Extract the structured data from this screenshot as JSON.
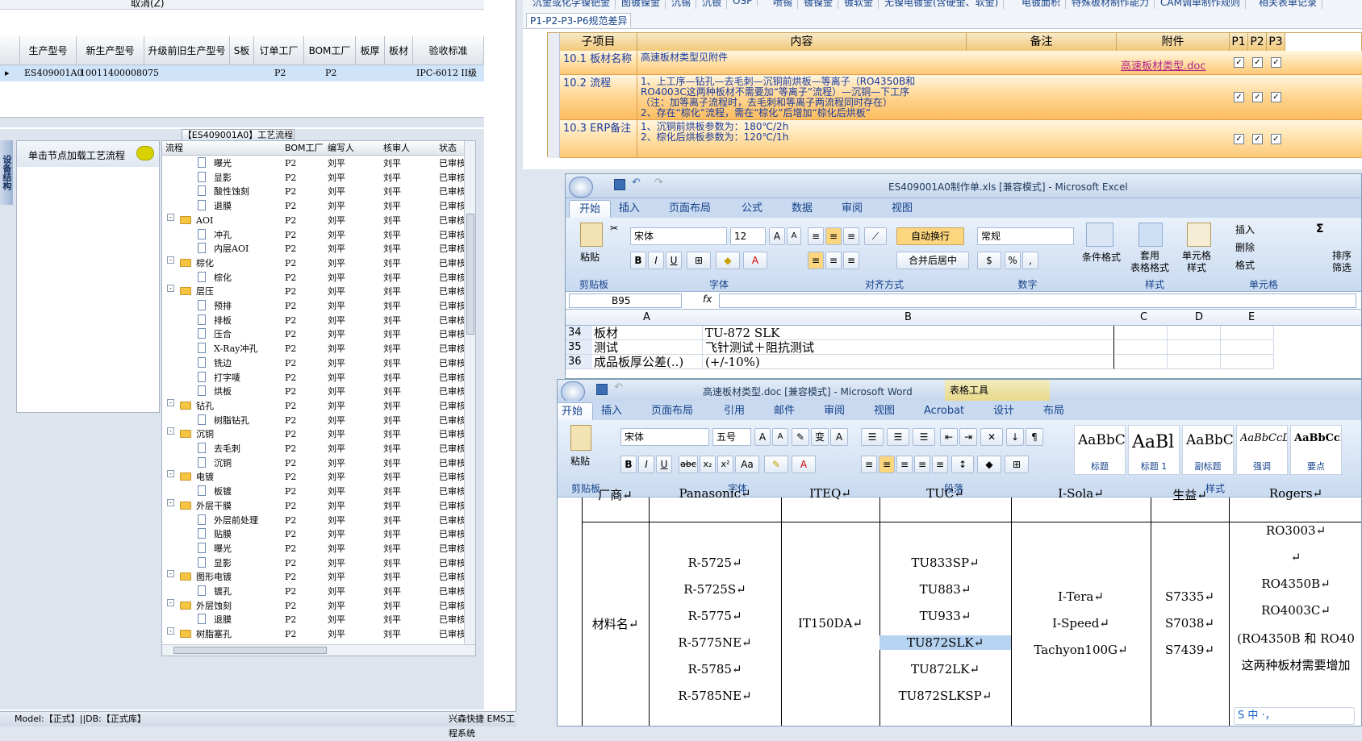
{
  "left": {
    "top_cancel": "取消(Z)",
    "grid_headers": [
      "生产型号",
      "新生产型号",
      "升级前旧生产型号",
      "S板",
      "订单工厂",
      "BOM工厂",
      "板厚",
      "板材",
      "验收标准"
    ],
    "grid_row": {
      "col1": "ES409001A0",
      "col2": "10011400008075",
      "order_factory": "P2",
      "bom_factory": "P2",
      "standard": "IPC-6012 II级"
    },
    "panel_title": "【ES409001A0】工艺流程",
    "side_tab": "设备结构",
    "node_load": "单击节点加载工艺流程",
    "tree_headers": [
      "流程",
      "BOM工厂",
      "编写人",
      "核审人",
      "状态"
    ],
    "tree_rows": [
      {
        "name": "曝光",
        "type": "doc",
        "level": 2,
        "f": "P2",
        "w": "刘平",
        "r": "刘平",
        "s": "已审核"
      },
      {
        "name": "显影",
        "type": "doc",
        "level": 2,
        "f": "P2",
        "w": "刘平",
        "r": "刘平",
        "s": "已审核"
      },
      {
        "name": "酸性蚀刻",
        "type": "doc",
        "level": 2,
        "f": "P2",
        "w": "刘平",
        "r": "刘平",
        "s": "已审核"
      },
      {
        "name": "退膜",
        "type": "doc",
        "level": 2,
        "f": "P2",
        "w": "刘平",
        "r": "刘平",
        "s": "已审核"
      },
      {
        "name": "AOI",
        "type": "folder",
        "level": 1,
        "f": "P2",
        "w": "刘平",
        "r": "刘平",
        "s": "已审核"
      },
      {
        "name": "冲孔",
        "type": "doc",
        "level": 2,
        "f": "P2",
        "w": "刘平",
        "r": "刘平",
        "s": "已审核"
      },
      {
        "name": "内层AOI",
        "type": "doc",
        "level": 2,
        "f": "P2",
        "w": "刘平",
        "r": "刘平",
        "s": "已审核"
      },
      {
        "name": "棕化",
        "type": "folder",
        "level": 1,
        "f": "P2",
        "w": "刘平",
        "r": "刘平",
        "s": "已审核"
      },
      {
        "name": "棕化",
        "type": "doc",
        "level": 2,
        "f": "P2",
        "w": "刘平",
        "r": "刘平",
        "s": "已审核"
      },
      {
        "name": "层压",
        "type": "folder",
        "level": 1,
        "f": "P2",
        "w": "刘平",
        "r": "刘平",
        "s": "已审核"
      },
      {
        "name": "预排",
        "type": "doc",
        "level": 2,
        "f": "P2",
        "w": "刘平",
        "r": "刘平",
        "s": "已审核"
      },
      {
        "name": "排板",
        "type": "doc",
        "level": 2,
        "f": "P2",
        "w": "刘平",
        "r": "刘平",
        "s": "已审核"
      },
      {
        "name": "压合",
        "type": "doc",
        "level": 2,
        "f": "P2",
        "w": "刘平",
        "r": "刘平",
        "s": "已审核"
      },
      {
        "name": "X-Ray冲孔",
        "type": "doc",
        "level": 2,
        "f": "P2",
        "w": "刘平",
        "r": "刘平",
        "s": "已审核"
      },
      {
        "name": "铣边",
        "type": "doc",
        "level": 2,
        "f": "P2",
        "w": "刘平",
        "r": "刘平",
        "s": "已审核"
      },
      {
        "name": "打字唛",
        "type": "doc",
        "level": 2,
        "f": "P2",
        "w": "刘平",
        "r": "刘平",
        "s": "已审核"
      },
      {
        "name": "烘板",
        "type": "doc",
        "level": 2,
        "f": "P2",
        "w": "刘平",
        "r": "刘平",
        "s": "已审核"
      },
      {
        "name": "钻孔",
        "type": "folder",
        "level": 1,
        "f": "P2",
        "w": "刘平",
        "r": "刘平",
        "s": "已审核"
      },
      {
        "name": "树脂钻孔",
        "type": "doc",
        "level": 2,
        "f": "P2",
        "w": "刘平",
        "r": "刘平",
        "s": "已审核"
      },
      {
        "name": "沉铜",
        "type": "folder",
        "level": 1,
        "f": "P2",
        "w": "刘平",
        "r": "刘平",
        "s": "已审核"
      },
      {
        "name": "去毛刺",
        "type": "doc",
        "level": 2,
        "f": "P2",
        "w": "刘平",
        "r": "刘平",
        "s": "已审核"
      },
      {
        "name": "沉铜",
        "type": "doc",
        "level": 2,
        "f": "P2",
        "w": "刘平",
        "r": "刘平",
        "s": "已审核"
      },
      {
        "name": "电镀",
        "type": "folder",
        "level": 1,
        "f": "P2",
        "w": "刘平",
        "r": "刘平",
        "s": "已审核"
      },
      {
        "name": "板镀",
        "type": "doc",
        "level": 2,
        "f": "P2",
        "w": "刘平",
        "r": "刘平",
        "s": "已审核"
      },
      {
        "name": "外层干膜",
        "type": "folder",
        "level": 1,
        "f": "P2",
        "w": "刘平",
        "r": "刘平",
        "s": "已审核"
      },
      {
        "name": "外层前处理",
        "type": "doc",
        "level": 2,
        "f": "P2",
        "w": "刘平",
        "r": "刘平",
        "s": "已审核"
      },
      {
        "name": "贴膜",
        "type": "doc",
        "level": 2,
        "f": "P2",
        "w": "刘平",
        "r": "刘平",
        "s": "已审核"
      },
      {
        "name": "曝光",
        "type": "doc",
        "level": 2,
        "f": "P2",
        "w": "刘平",
        "r": "刘平",
        "s": "已审核"
      },
      {
        "name": "显影",
        "type": "doc",
        "level": 2,
        "f": "P2",
        "w": "刘平",
        "r": "刘平",
        "s": "已审核"
      },
      {
        "name": "图形电镀",
        "type": "folder",
        "level": 1,
        "f": "P2",
        "w": "刘平",
        "r": "刘平",
        "s": "已审核"
      },
      {
        "name": "镀孔",
        "type": "doc",
        "level": 2,
        "f": "P2",
        "w": "刘平",
        "r": "刘平",
        "s": "已审核"
      },
      {
        "name": "外层蚀刻",
        "type": "folder",
        "level": 1,
        "f": "P2",
        "w": "刘平",
        "r": "刘平",
        "s": "已审核"
      },
      {
        "name": "退膜",
        "type": "doc",
        "level": 2,
        "f": "P2",
        "w": "刘平",
        "r": "刘平",
        "s": "已审核"
      },
      {
        "name": "树脂塞孔",
        "type": "folder",
        "level": 1,
        "f": "P2",
        "w": "刘平",
        "r": "刘平",
        "s": "已审核"
      }
    ],
    "status_bar": "Model:【正式】||DB:【正式库】",
    "status_right": "兴森快捷  EMS工程系统"
  },
  "rtop": {
    "tabs": [
      "沉金或化学镍钯金",
      "图镀镍金",
      "沉锡",
      "沉银",
      "OSP",
      "喷锡",
      "镀镍金",
      "镀软金",
      "无镍电镀金(含硬金、软金)",
      "电镀面积",
      "特殊板材制作能力",
      "CAM调单制作规则",
      "相关表单记录"
    ],
    "subtab": "P1-P2-P3-P6规范差异",
    "headers": [
      "子项目",
      "内容",
      "备注",
      "附件",
      "P1",
      "P2",
      "P3"
    ],
    "rows": [
      {
        "item": "10.1 板材名称",
        "content": [
          "高速板材类型见附件"
        ],
        "attach": "高速板材类型.doc"
      },
      {
        "item": "10.2 流程",
        "content": [
          "1、上工序—钻孔—去毛刺—沉铜前烘板—等离子（RO4350B和",
          "RO4003C这两种板材不需要加“等离子”流程）—沉铜—下工序",
          "（注：加等离子流程时，去毛刺和等离子两流程同时存在）",
          "2、存在“棕化”流程，需在“棕化”后增加“棕化后烘板”"
        ],
        "attach": ""
      },
      {
        "item": "10.3 ERP备注",
        "content": [
          "1、沉铜前烘板参数为：180℃/2h",
          "2、棕化后烘板参数为：120℃/1h"
        ],
        "attach": ""
      }
    ],
    "check_mark": "✓"
  },
  "excel": {
    "title": "ES409001A0制作单.xls  [兼容模式] - Microsoft Excel",
    "tabs": [
      "开始",
      "插入",
      "页面布局",
      "公式",
      "数据",
      "审阅",
      "视图"
    ],
    "font_name": "宋体",
    "font_size": "12",
    "number_format": "常规",
    "wrap": "自动换行",
    "merge": "合并后居中",
    "buttons": {
      "paste": "粘贴",
      "cond": "条件格式",
      "table": "套用\n表格格式",
      "cellstyle": "单元格\n样式",
      "insert": "插入",
      "delete": "删除",
      "format": "格式",
      "sort": "排序\n筛选"
    },
    "groups": [
      "剪贴板",
      "字体",
      "对齐方式",
      "数字",
      "样式",
      "单元格"
    ],
    "namebox": "B95",
    "fx": "fx",
    "cols": [
      "A",
      "B",
      "C",
      "D",
      "E"
    ],
    "rows": [
      {
        "n": "34",
        "a": "板材",
        "b": "TU-872 SLK"
      },
      {
        "n": "35",
        "a": "测试",
        "b": "飞针测试＋阻抗测试"
      },
      {
        "n": "36",
        "a": "成品板厚公差(..)",
        "b": "(+/-10%)"
      }
    ]
  },
  "word": {
    "title": "高速板材类型.doc [兼容模式] - Microsoft Word",
    "tools": "表格工具",
    "tabs": [
      "开始",
      "插入",
      "页面布局",
      "引用",
      "邮件",
      "审阅",
      "视图",
      "Acrobat",
      "设计",
      "布局"
    ],
    "font_name": "宋体",
    "font_size": "五号",
    "styles": [
      {
        "sample": "AaBbC",
        "name": "标题"
      },
      {
        "sample": "AaBl",
        "name": "标题 1"
      },
      {
        "sample": "AaBbC",
        "name": "副标题"
      },
      {
        "sample": "AaBbCcD",
        "name": "强调"
      },
      {
        "sample": "AaBbCcD",
        "name": "要点"
      }
    ],
    "groups": [
      "剪贴板",
      "字体",
      "段落",
      "样式"
    ],
    "paste": "粘贴",
    "table": {
      "header": [
        "厂商↵",
        "Panasonic↵",
        "ITEQ↵",
        "TUC↵",
        "I-Sola↵",
        "生益↵",
        "Rogers↵"
      ],
      "row_label": "材料名↵",
      "col1": [
        "R-5725↵",
        "R-5725S↵",
        "R-5775↵",
        "R-5775NE↵",
        "R-5785↵",
        "R-5785NE↵"
      ],
      "col2": [
        "IT150DA↵"
      ],
      "col3": [
        "TU833SP↵",
        "TU883↵",
        "TU933↵",
        "TU872SLK↵",
        "TU872LK↵",
        "TU872SLKSP↵"
      ],
      "col4": [
        "I-Tera↵",
        "I-Speed↵",
        "Tachyon100G↵"
      ],
      "col5": [
        "S7335↵",
        "S7038↵",
        "S7439↵"
      ],
      "col6": [
        "RO3003↵",
        "↵",
        "RO4350B↵",
        "RO4003C↵",
        "(RO4350B 和 RO40",
        "这两种板材需要增加"
      ]
    },
    "ime": "S 中 ·，"
  }
}
